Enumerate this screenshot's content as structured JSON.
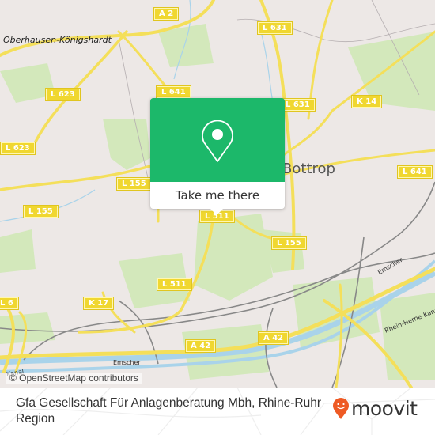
{
  "map": {
    "attribution": "© OpenStreetMap contributors",
    "places": {
      "city": "Bottrop",
      "town": "Oberhausen-Königshardt"
    },
    "water_labels": {
      "emscher_1": "Emscher",
      "emscher_2": "Emscher",
      "canal": "Rhein-Herne-Kanal",
      "kanal_left": "Kanal"
    },
    "road_shields": {
      "a2": "A 2",
      "l631_top": "L 631",
      "l631_mid": "L 631",
      "l641_top": "L 641",
      "l641_right": "L 641",
      "l623_a": "L 623",
      "l623_b": "L 623",
      "k14": "K 14",
      "l155_a": "L 155",
      "l155_b": "L 155",
      "l155_c": "L 155",
      "l511_top": "L 511",
      "l511_bottom": "L 511",
      "k17": "K 17",
      "a42_left": "A 42",
      "a42_right": "A 42",
      "l6_edge": "L 6"
    },
    "colors": {
      "land": "#ede8e6",
      "green": "#cfe6b3",
      "road": "#f4df5a",
      "water": "#a9d3ea"
    }
  },
  "popup": {
    "icon": "map-pin-icon",
    "cta_label": "Take me there",
    "color": "#1cb86a"
  },
  "footer": {
    "place_name": "Gfa Gesellschaft Für Anlagenberatung Mbh, Rhine-Ruhr Region",
    "brand": "moovit",
    "brand_icon": "moovit-smiley-pin-icon",
    "brand_color": "#ee5a24"
  }
}
